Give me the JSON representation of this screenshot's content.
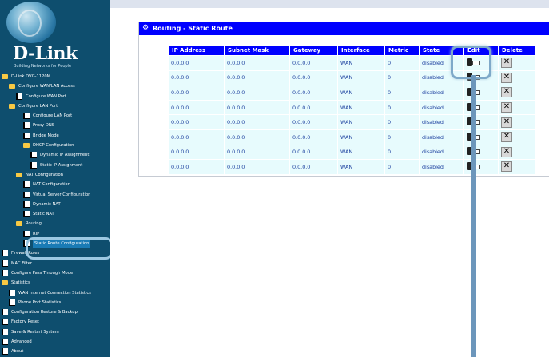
{
  "brand": {
    "name": "D-Link",
    "tagline": "Building Networks for People"
  },
  "sidebar": {
    "items": [
      {
        "label": "D-Link DVG-1120M",
        "indent": 0,
        "type": "folder"
      },
      {
        "label": "Configure WAN/LAN Access",
        "indent": 1,
        "type": "folder"
      },
      {
        "label": "Configure WAN Port",
        "indent": 2,
        "type": "page"
      },
      {
        "label": "Configure LAN Port",
        "indent": 1,
        "type": "folder"
      },
      {
        "label": "Configure LAN Port",
        "indent": 3,
        "type": "page"
      },
      {
        "label": "Proxy DNS",
        "indent": 3,
        "type": "page"
      },
      {
        "label": "Bridge Mode",
        "indent": 3,
        "type": "page"
      },
      {
        "label": "DHCP Configuration",
        "indent": 3,
        "type": "folder"
      },
      {
        "label": "Dynamic IP Assignment",
        "indent": 4,
        "type": "page"
      },
      {
        "label": "Static IP Assignment",
        "indent": 4,
        "type": "page"
      },
      {
        "label": "NAT Configuration",
        "indent": 2,
        "type": "folder"
      },
      {
        "label": "NAT Configuration",
        "indent": 3,
        "type": "page"
      },
      {
        "label": "Virtual Server Configuration",
        "indent": 3,
        "type": "page"
      },
      {
        "label": "Dynamic NAT",
        "indent": 3,
        "type": "page"
      },
      {
        "label": "Static NAT",
        "indent": 3,
        "type": "page"
      },
      {
        "label": "Routing",
        "indent": 2,
        "type": "folder"
      },
      {
        "label": "RIP",
        "indent": 3,
        "type": "page"
      },
      {
        "label": "Static Route Configuration",
        "indent": 3,
        "type": "page",
        "selected": true
      },
      {
        "label": "Firewall Rules",
        "indent": 0,
        "type": "page"
      },
      {
        "label": "MAC Filter",
        "indent": 0,
        "type": "page"
      },
      {
        "label": "Configure Pass Through Mode",
        "indent": 0,
        "type": "page"
      },
      {
        "label": "Statistics",
        "indent": 0,
        "type": "folder"
      },
      {
        "label": "WAN Internet Connection Statistics",
        "indent": 1,
        "type": "page"
      },
      {
        "label": "Phone Port Statistics",
        "indent": 1,
        "type": "page"
      },
      {
        "label": "Configuration Restore & Backup",
        "indent": 0,
        "type": "page"
      },
      {
        "label": "Factory Reset",
        "indent": 0,
        "type": "page"
      },
      {
        "label": "Save & Restart System",
        "indent": 0,
        "type": "page"
      },
      {
        "label": "Advanced",
        "indent": 0,
        "type": "page"
      },
      {
        "label": "About",
        "indent": 0,
        "type": "page"
      }
    ]
  },
  "panel": {
    "title": "Routing - Static Route",
    "columns": [
      "IP Address",
      "Subnet Mask",
      "Gateway",
      "Interface",
      "Metric",
      "State",
      "Edit",
      "Delete"
    ],
    "rows": [
      {
        "ip": "0.0.0.0",
        "mask": "0.0.0.0",
        "gateway": "0.0.0.0",
        "interface": "WAN",
        "metric": "0",
        "state": "disabled"
      },
      {
        "ip": "0.0.0.0",
        "mask": "0.0.0.0",
        "gateway": "0.0.0.0",
        "interface": "WAN",
        "metric": "0",
        "state": "disabled"
      },
      {
        "ip": "0.0.0.0",
        "mask": "0.0.0.0",
        "gateway": "0.0.0.0",
        "interface": "WAN",
        "metric": "0",
        "state": "disabled"
      },
      {
        "ip": "0.0.0.0",
        "mask": "0.0.0.0",
        "gateway": "0.0.0.0",
        "interface": "WAN",
        "metric": "0",
        "state": "disabled"
      },
      {
        "ip": "0.0.0.0",
        "mask": "0.0.0.0",
        "gateway": "0.0.0.0",
        "interface": "WAN",
        "metric": "0",
        "state": "disabled"
      },
      {
        "ip": "0.0.0.0",
        "mask": "0.0.0.0",
        "gateway": "0.0.0.0",
        "interface": "WAN",
        "metric": "0",
        "state": "disabled"
      },
      {
        "ip": "0.0.0.0",
        "mask": "0.0.0.0",
        "gateway": "0.0.0.0",
        "interface": "WAN",
        "metric": "0",
        "state": "disabled"
      },
      {
        "ip": "0.0.0.0",
        "mask": "0.0.0.0",
        "gateway": "0.0.0.0",
        "interface": "WAN",
        "metric": "0",
        "state": "disabled"
      }
    ]
  },
  "colors": {
    "sidebar_bg": "#0e4e6e",
    "title_bar": "#0000ff",
    "row_bg": "#e7fbfd",
    "highlight": "#7ea9c9"
  },
  "icons": {
    "edit": "edit-icon",
    "delete": "delete-icon",
    "page": "page-icon",
    "folder": "folder-icon"
  }
}
